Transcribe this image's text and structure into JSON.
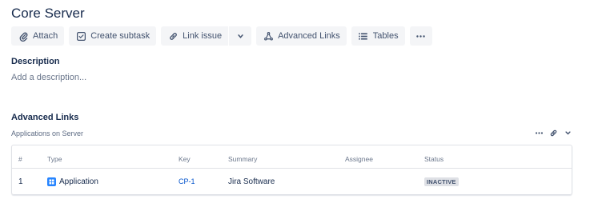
{
  "issue": {
    "title": "Core Server"
  },
  "toolbar": {
    "attach_label": "Attach",
    "create_subtask_label": "Create subtask",
    "link_issue_label": "Link issue",
    "advanced_links_label": "Advanced Links",
    "tables_label": "Tables"
  },
  "description": {
    "heading": "Description",
    "placeholder": "Add a description..."
  },
  "advanced_links": {
    "heading": "Advanced Links",
    "subheading": "Applications on Server",
    "columns": [
      "#",
      "Type",
      "Key",
      "Summary",
      "Assignee",
      "Status"
    ],
    "rows": [
      {
        "num": "1",
        "type": "Application",
        "key": "CP-1",
        "summary": "Jira Software",
        "assignee": "",
        "status": "INACTIVE"
      }
    ]
  },
  "colors": {
    "accent": "#0052cc",
    "type_icon": "#2684ff"
  }
}
